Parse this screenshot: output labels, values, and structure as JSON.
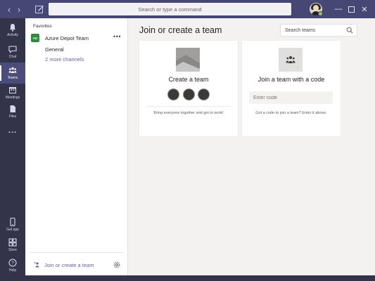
{
  "titlebar": {
    "search_placeholder": "Search or type a command"
  },
  "rail": {
    "items": [
      {
        "label": "Activity",
        "icon": "bell-icon"
      },
      {
        "label": "Chat",
        "icon": "chat-icon"
      },
      {
        "label": "Teams",
        "icon": "teams-icon",
        "active": true
      },
      {
        "label": "Meetings",
        "icon": "calendar-icon"
      },
      {
        "label": "Files",
        "icon": "file-icon"
      },
      {
        "label": "...",
        "icon": "more-icon"
      },
      {
        "label": "Get app",
        "icon": "phone-icon"
      },
      {
        "label": "Store",
        "icon": "store-icon"
      },
      {
        "label": "Help",
        "icon": "help-icon"
      }
    ]
  },
  "list": {
    "favorites_label": "Favorites",
    "team": {
      "badge": "AD",
      "name": "Azure Depot Team",
      "more": "•••"
    },
    "channel": "General",
    "more_channels": "2 more channels",
    "join_link": "Join or create a team"
  },
  "main": {
    "title": "Join or create a team",
    "search_placeholder": "Search teams",
    "create_card": {
      "title": "Create a team",
      "desc": "Bring everyone together and get to work!"
    },
    "join_card": {
      "title": "Join a team with a code",
      "code_placeholder": "Enter code",
      "desc": "Got a code to join a team? Enter it above."
    }
  },
  "colors": {
    "accent": "#6264a7",
    "titlebar": "#464775",
    "rail": "#33344a",
    "team_badge": "#2e8b3c"
  }
}
